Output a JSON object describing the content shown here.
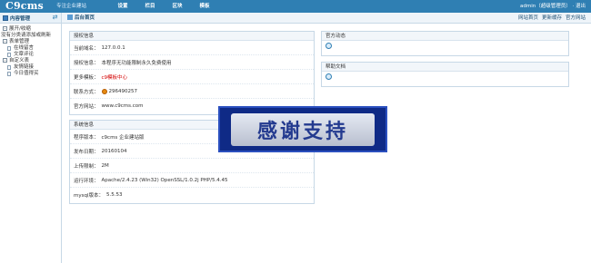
{
  "header": {
    "logo": "C9cms",
    "tagline": "专注企业建站",
    "nav": [
      "设置",
      "栏目",
      "区块",
      "模板"
    ],
    "userinfo": "admin（超级管理员） · 退出"
  },
  "sidebar": {
    "title": "内容管理",
    "items": [
      {
        "label": "展开/收缩",
        "kind": "group"
      },
      {
        "label": "没有分类请添加或刷新",
        "kind": "text"
      },
      {
        "label": "表单管理",
        "kind": "group"
      },
      {
        "label": "在线留言",
        "kind": "sub"
      },
      {
        "label": "文章评论",
        "kind": "sub"
      },
      {
        "label": "自定义表",
        "kind": "group"
      },
      {
        "label": "友情链接",
        "kind": "sub"
      },
      {
        "label": "今日值得买",
        "kind": "sub"
      }
    ]
  },
  "breadcrumb": {
    "label": "后台首页",
    "links": [
      "网站首页",
      "更新缓存",
      "官方网站"
    ]
  },
  "license_panel": {
    "title": "授权信息",
    "rows": [
      {
        "k": "当前域名：",
        "v": "127.0.0.1"
      },
      {
        "k": "授权信息：",
        "v": "本程序无功能限制永久免费使用"
      },
      {
        "k": "更多模板：",
        "v": "c9模板中心"
      },
      {
        "k": "联系方式：",
        "v": "296490257"
      },
      {
        "k": "官方网站：",
        "v": "www.c9cms.com"
      }
    ]
  },
  "system_panel": {
    "title": "系统信息",
    "rows": [
      {
        "k": "程序版本：",
        "v": "c9cms 企业建站版"
      },
      {
        "k": "发布日期：",
        "v": "20160104"
      },
      {
        "k": "上传限制：",
        "v": "2M"
      },
      {
        "k": "运行环境：",
        "v": "Apache/2.4.23 (Win32) OpenSSL/1.0.2j PHP/5.4.45"
      },
      {
        "k": "mysql版本：",
        "v": "5.5.53"
      }
    ]
  },
  "news_panel": {
    "title": "官方动态"
  },
  "help_panel": {
    "title": "帮助文档"
  },
  "watermark": {
    "text": "感谢支持"
  },
  "colors": {
    "topbar": "#2f7fb3",
    "accent_red": "#d40000",
    "watermark_bg": "#0f2a86"
  }
}
